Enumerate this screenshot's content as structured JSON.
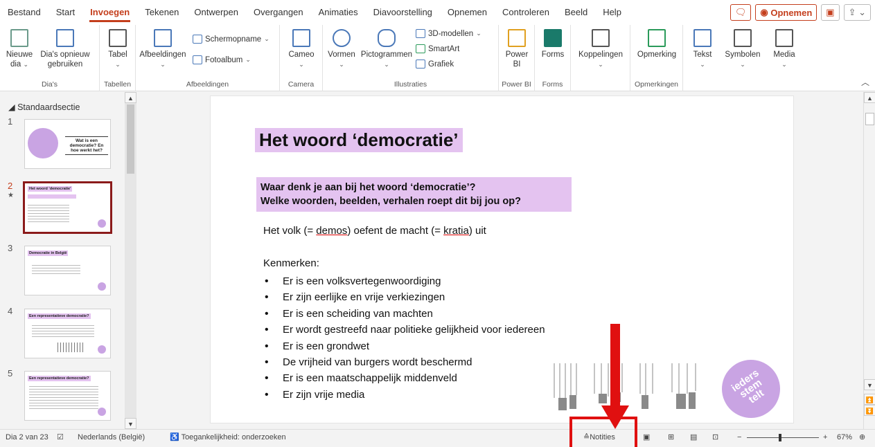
{
  "tabs": [
    "Bestand",
    "Start",
    "Invoegen",
    "Tekenen",
    "Ontwerpen",
    "Overgangen",
    "Animaties",
    "Diavoorstelling",
    "Opnemen",
    "Controleren",
    "Beeld",
    "Help"
  ],
  "active_tab": "Invoegen",
  "record_label": "Opnemen",
  "ribbon": {
    "new_slide": "Nieuwe dia",
    "reuse": "Dia's opnieuw gebruiken",
    "table": "Tabel",
    "images": "Afbeeldingen",
    "screenshot": "Schermopname",
    "photo_album": "Fotoalbum",
    "cameo": "Cameo",
    "shapes": "Vormen",
    "icons": "Pictogrammen",
    "models3d": "3D-modellen",
    "smartart": "SmartArt",
    "chart": "Grafiek",
    "powerbi": "Power BI",
    "forms": "Forms",
    "links": "Koppelingen",
    "comment": "Opmerking",
    "text": "Tekst",
    "symbols": "Symbolen",
    "media": "Media",
    "groups": {
      "slides": "Dia's",
      "tables": "Tabellen",
      "images": "Afbeeldingen",
      "camera": "Camera",
      "illustrations": "Illustraties",
      "powerbi": "Power BI",
      "forms": "Forms",
      "comments": "Opmerkingen"
    }
  },
  "panel": {
    "section": "Standaardsectie",
    "thumbs": [
      {
        "num": "1",
        "text": "Wat is een democratie? En hoe werkt het?"
      },
      {
        "num": "2",
        "text": "Het woord 'democratie'"
      },
      {
        "num": "3",
        "text": "Democratie in België"
      },
      {
        "num": "4",
        "text": "Een representatieve democratie?"
      },
      {
        "num": "5",
        "text": "Een representatieve democratie?"
      }
    ]
  },
  "slide": {
    "title": "Het woord ‘democratie’",
    "question_1": "Waar denk je aan bij het woord ‘democratie’?",
    "question_2": "Welke woorden, beelden, verhalen roept dit bij jou op?",
    "line_pre": "Het volk (= ",
    "word_demos": "demos",
    "line_mid": ") oefent de macht (= ",
    "word_kratia": "kratia",
    "line_post": ") uit",
    "features_label": "Kenmerken:",
    "bullets": [
      "Er is een volksvertegenwoordiging",
      "Er zijn eerlijke en vrije verkiezingen",
      "Er is een scheiding van machten",
      "Er wordt gestreefd naar politieke gelijkheid voor iedereen",
      "Er is een grondwet",
      "De vrijheid van burgers wordt beschermd",
      "Er is een maatschappelijk middenveld",
      "Er zijn vrije media"
    ],
    "logo_text": "ieders stem telt"
  },
  "status": {
    "slide_of": "Dia 2 van 23",
    "language": "Nederlands (België)",
    "accessibility": "Toegankelijkheid: onderzoeken",
    "notes": "Notities",
    "zoom": "67%"
  },
  "colors": {
    "accent": "#c43e1c",
    "highlight": "#e4c3f0",
    "annotation": "#e01010"
  }
}
